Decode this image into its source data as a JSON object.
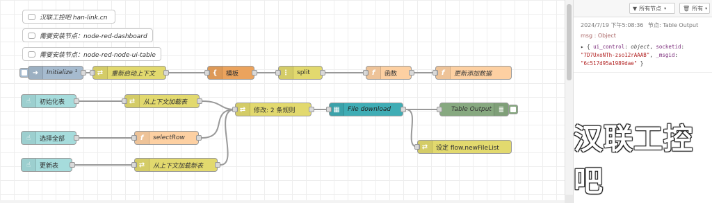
{
  "comments": [
    "汉联工控吧 han-link.cn",
    "需要安装节点：node-red-dashboard",
    "需要安装节点：node-red-node-ui-table"
  ],
  "nodes": {
    "initialize": {
      "label": "Initialize ¹",
      "color": "#a6bbcf",
      "icon": "arrow-right-icon"
    },
    "reset_context": {
      "label": "重新启动上下文",
      "color": "#e2d96e",
      "icon": "shuffle-icon"
    },
    "template": {
      "label": "模板",
      "color": "#eba35d",
      "icon": "braces-icon"
    },
    "split": {
      "label": "split",
      "color": "#e2d96e",
      "icon": "split-icon"
    },
    "function": {
      "label": "函数",
      "color": "#fdd0a2",
      "icon": "function-icon"
    },
    "update_data": {
      "label": "更新添加数据",
      "color": "#fdd0a2",
      "icon": "function-icon"
    },
    "init_table": {
      "label": "初始化表",
      "color": "#a6dcdc",
      "icon": "hand-icon"
    },
    "load_table": {
      "label": "从上下文加载表",
      "color": "#e2d96e",
      "icon": "shuffle-icon"
    },
    "change_rules": {
      "label": "修改: 2 条规则",
      "color": "#e2d96e",
      "icon": "shuffle-icon"
    },
    "file_download": {
      "label": "File download",
      "color": "#3fadb5",
      "icon": "table-icon"
    },
    "table_output": {
      "label": "Table Output",
      "color": "#87a980",
      "icon": "list-icon"
    },
    "select_all": {
      "label": "选择全部",
      "color": "#a6dcdc",
      "icon": "hand-icon"
    },
    "select_row": {
      "label": "selectRow",
      "color": "#fdd0a2",
      "icon": "function-icon"
    },
    "set_filelist": {
      "label": "设定 flow.newFileList",
      "color": "#e2d96e",
      "icon": "shuffle-icon"
    },
    "refresh_table": {
      "label": "更新表",
      "color": "#a6dcdc",
      "icon": "hand-icon"
    },
    "load_new_table": {
      "label": "从上下文加载新表",
      "color": "#e2d96e",
      "icon": "shuffle-icon"
    }
  },
  "sidebar": {
    "filter_nodes_label": "所有节点",
    "filter_all_label": "所有",
    "message": {
      "timestamp": "2024/7/19 下午5:08:36",
      "node_label": "节点: Table Output",
      "topic": "msg : Object",
      "payload_key1": "ui_control",
      "payload_val1": "object",
      "payload_key2": "socketid",
      "payload_val2": "\"7D7UxoNTh-zso12rAAAB\"",
      "payload_key3": "_msgid",
      "payload_val3": "\"6c517d95a1989dae\""
    }
  },
  "watermark": "汉联工控吧"
}
